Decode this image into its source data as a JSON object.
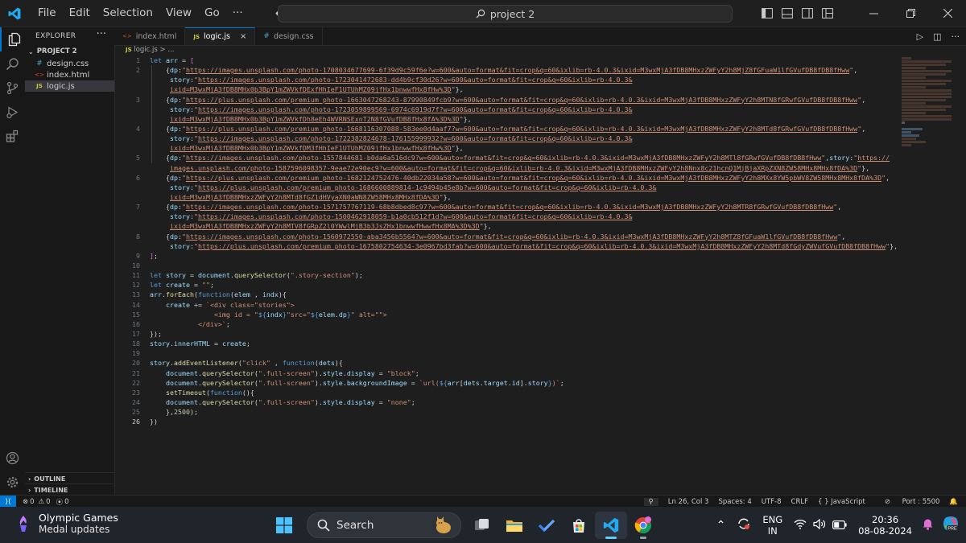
{
  "menu": [
    "File",
    "Edit",
    "Selection",
    "View",
    "Go"
  ],
  "menu_more": "···",
  "search_text": "project 2",
  "explorer": {
    "title": "EXPLORER",
    "more": "···",
    "project": "PROJECT 2",
    "files": [
      {
        "name": "design.css",
        "icon": "#",
        "color": "#519aba"
      },
      {
        "name": "index.html",
        "icon": "<>",
        "color": "#e44d26"
      },
      {
        "name": "logic.js",
        "icon": "JS",
        "color": "#cbcb41"
      }
    ],
    "outline": "OUTLINE",
    "timeline": "TIMELINE"
  },
  "tabs": [
    {
      "name": "index.html",
      "icon": "<>",
      "color": "#e44d26",
      "active": false
    },
    {
      "name": "logic.js",
      "icon": "JS",
      "color": "#cbcb41",
      "active": true,
      "close": "×"
    },
    {
      "name": "design.css",
      "icon": "#",
      "color": "#519aba",
      "active": false
    }
  ],
  "breadcrumb": {
    "icon": "JS",
    "file": "logic.js",
    "sep": ">",
    "rest": "..."
  },
  "status": {
    "errors": "0",
    "warnings": "0",
    "ports": "0",
    "position": "Ln 26, Col 3",
    "spaces": "Spaces: 4",
    "encoding": "UTF-8",
    "eol": "CRLF",
    "language": "{ } JavaScript",
    "port": "Port : 5500"
  },
  "taskbar": {
    "weather_title": "Olympic Games",
    "weather_sub": "Medal updates",
    "search_label": "Search",
    "lang_1": "ENG",
    "lang_2": "IN",
    "time": "20:36",
    "date": "08-08-2024"
  },
  "code_lines": [
    {
      "n": "1",
      "html": "<span class='kw'>let</span> <span class='vr'>arr</span> = <span class='br'>[</span>"
    },
    {
      "n": "2",
      "html": "    {<span class='vr'>dp</span>:<span class='str'>\"<span class='url'>https://images.unsplash.com/photo-1708034677699-6f39d9c59f6e?w=600&amp;auto=format&amp;fit=crop&amp;q=60&amp;ixlib=rb-4.0.3&amp;ixid=M3wxMjA3fDB8MHxzZWFyY2h8MjZ8fGFuaW1lfGVufDB8fDB8fHww</span>\"</span>,"
    },
    {
      "n": "",
      "html": "     <span class='vr'>story</span>:<span class='str'>\"<span class='url'>https://images.unsplash.com/photo-1723041472683-dd4b9cf30d26?w=600&amp;auto=format&amp;fit=crop&amp;q=60&amp;ixlib=rb-4.0.3&amp;</span></span>"
    },
    {
      "n": "",
      "html": "     <span class='str url'>ixid=M3wxMjA3fDB8MHx0b3BpY1mZWVkfDExfHhIeF1UTUhMZ09jfHx1bnwwfHx8fHw%3D</span><span class='str'>\"</span>},"
    },
    {
      "n": "3",
      "html": "    {<span class='vr'>dp</span>:<span class='str'>\"<span class='url'>https://plus.unsplash.com/premium_photo-1663047268243-87990849fcb9?w=600&amp;auto=format&amp;fit=crop&amp;q=60&amp;ixlib=rb-4.0.3&amp;ixid=M3wxMjA3fDB8MHxzZWFyY2h8MTN8fGRwfGVufDB8fDB8fHww</span>\"</span>,"
    },
    {
      "n": "",
      "html": "     <span class='vr'>story</span>:<span class='str'>\"<span class='url'>https://images.unsplash.com/photo-1723059899569-6974c6919d7f?w=600&amp;auto=format&amp;fit=crop&amp;q=60&amp;ixlib=rb-4.0.3&amp;</span></span>"
    },
    {
      "n": "",
      "html": "     <span class='str url'>ixid=M3wxMjA3fDB8MHx0b3BpY1mZWVkfDh8eEh4WVRNSExnT2N8fGVufDB8fHx8fA%3D%3D</span><span class='str'>\"</span>},"
    },
    {
      "n": "4",
      "html": "    {<span class='vr'>dp</span>:<span class='str'>\"<span class='url'>https://plus.unsplash.com/premium_photo-1668116307088-583ee0d4aaf7?w=600&amp;auto=format&amp;fit=crop&amp;q=60&amp;ixlib=rb-4.0.3&amp;ixid=M3wxMjA3fDB8MHxzZWFyY2h8MTd8fGRwfGVufDB8fDB8fHww</span>\"</span>,"
    },
    {
      "n": "",
      "html": "     <span class='vr'>story</span>:<span class='str'>\"<span class='url'>https://images.unsplash.com/photo-1722382824678-176155999932?w=600&amp;auto=format&amp;fit=crop&amp;q=60&amp;ixlib=rb-4.0.3&amp;</span></span>"
    },
    {
      "n": "",
      "html": "     <span class='str url'>ixid=M3wxMjA3fDB8MHx0b3BpY1mZWVkfDM3fHhIeF1UTUhMZ09jfHx1bnwwfHx8fHw%3D</span><span class='str'>\"</span>},"
    },
    {
      "n": "5",
      "html": "    {<span class='vr'>dp</span>:<span class='str'>\"<span class='url'>https://images.unsplash.com/photo-1557844681-b0da6a516dc9?w=600&amp;auto=format&amp;fit=crop&amp;q=60&amp;ixlib=rb-4.0.3&amp;ixid=M3wxMjA3fDB8MHxzZWFyY2h8MTl8fGRwfGVufDB8fDB8fHww</span>\"</span>,<span class='vr'>story</span>:<span class='str'>\"<span class='url'>https://</span></span>"
    },
    {
      "n": "",
      "html": "     <span class='str url'>images.unsplash.com/photo-1587596098357-9eae72e90ec9?w=600&amp;auto=format&amp;fit=crop&amp;q=60&amp;ixlib=rb-4.0.3&amp;ixid=M3wxMjA3fDB8MHxzZWFyY2h8Nnx8c21hcnQ1MjBjaXRpZXN8ZW58MHx8MHx8fDA%3D</span><span class='str'>\"</span>},"
    },
    {
      "n": "6",
      "html": "    {<span class='vr'>dp</span>:<span class='str'>\"<span class='url'>https://plus.unsplash.com/premium_photo-1682124752476-40db22034a58?w=600&amp;auto=format&amp;fit=crop&amp;q=60&amp;ixlib=rb-4.0.3&amp;ixid=M3wxMjA3fDB8MHxzZWFyY2h8MXx8YW5pbWV8ZW58MHx8MHx8fDA%3D</span>\"</span>,"
    },
    {
      "n": "",
      "html": "     <span class='vr'>story</span>:<span class='str'>\"<span class='url'>https://plus.unsplash.com/premium_photo-1686600889814-1c9494b45e8b?w=600&amp;auto=format&amp;fit=crop&amp;q=60&amp;ixlib=rb-4.0.3&amp;</span></span>"
    },
    {
      "n": "",
      "html": "     <span class='str url'>ixid=M3wxMjA3fDB8MHxzZWFyY2h8MTd8fGZ1dHVyaXN0aWN8ZW58MHx8MHx8fDA%3D</span><span class='str'>\"</span>},"
    },
    {
      "n": "7",
      "html": "    {<span class='vr'>dp</span>:<span class='str'>\"<span class='url'>https://images.unsplash.com/photo-1571757767119-68b8dbed8c97?w=600&amp;auto=format&amp;fit=crop&amp;q=60&amp;ixlib=rb-4.0.3&amp;ixid=M3wxMjA3fDB8MHxzZWFyY2h8MTR8fGRwfGVufDB8fDB8fHww</span>\"</span>,"
    },
    {
      "n": "",
      "html": "     <span class='vr'>story</span>:<span class='str'>\"<span class='url'>https://images.unsplash.com/photo-1500462918059-b1a0cb512f1d?w=600&amp;auto=format&amp;fit=crop&amp;q=60&amp;ixlib=rb-4.0.3&amp;</span></span>"
    },
    {
      "n": "",
      "html": "     <span class='str url'>ixid=M3wxMjA3fDB8MHxzZWFyY2h8MTV8fGRpZ2l0YWwlMjB3b3JsZHx1bnwwfHwwfHx8MA%3D%3D</span><span class='str'>\"</span>},"
    },
    {
      "n": "8",
      "html": "    {<span class='vr'>dp</span>:<span class='str'>\"<span class='url'>https://images.unsplash.com/photo-1560972550-aba3456b5564?w=600&amp;auto=format&amp;fit=crop&amp;q=60&amp;ixlib=rb-4.0.3&amp;ixid=M3wxMjA3fDB8MHxzZWFyY2h8MTZ8fGFuaW1lfGVufDB8fDB8fHww</span>\"</span>,"
    },
    {
      "n": "",
      "html": "     <span class='vr'>story</span>:<span class='str'>\"<span class='url'>https://plus.unsplash.com/premium_photo-1675802754634-3e0967bd3fab?w=600&amp;auto=format&amp;fit=crop&amp;q=60&amp;ixlib=rb-4.0.3&amp;ixid=M3wxMjA3fDB8MHxzZWFyY2h8MTd8fGdyZWVufGVufDB8fDB8fHww</span>\"</span>},"
    },
    {
      "n": "9",
      "html": "<span class='br'>]</span>;"
    },
    {
      "n": "10",
      "html": ""
    },
    {
      "n": "11",
      "html": "<span class='kw'>let</span> <span class='vr'>story</span> = <span class='vr'>document</span>.<span class='fn'>querySelector</span>(<span class='str'>\".story-section\"</span>);"
    },
    {
      "n": "12",
      "html": "<span class='kw'>let</span> <span class='vr'>create</span> = <span class='str'>\"\"</span>;"
    },
    {
      "n": "13",
      "html": "<span class='vr'>arr</span>.<span class='fn'>forEach</span>(<span class='kw'>function</span>(<span class='vr'>elem</span> , <span class='vr'>indx</span>){"
    },
    {
      "n": "14",
      "html": "    <span class='vr'>create</span> += <span class='tm'>`&lt;div class=\"stories\"&gt;</span>"
    },
    {
      "n": "15",
      "html": "<span class='tm'>                &lt;img id = \"</span><span class='kw'>${</span><span class='vr'>indx</span><span class='kw'>}</span><span class='tm'>\"src=\"</span><span class='kw'>${</span><span class='vr'>elem</span>.<span class='vr'>dp</span><span class='kw'>}</span><span class='tm'>\" alt=\"\"&gt;</span>"
    },
    {
      "n": "16",
      "html": "<span class='tm'>            &lt;/div&gt;`</span>;"
    },
    {
      "n": "17",
      "html": "});"
    },
    {
      "n": "18",
      "html": "<span class='vr'>story</span>.<span class='vr'>innerHTML</span> = <span class='vr'>create</span>;"
    },
    {
      "n": "19",
      "html": ""
    },
    {
      "n": "20",
      "html": "<span class='vr'>story</span>.<span class='fn'>addEventListener</span>(<span class='str'>\"click\"</span> , <span class='kw'>function</span>(<span class='vr'>dets</span>){"
    },
    {
      "n": "21",
      "html": "    <span class='vr'>document</span>.<span class='fn'>querySelector</span>(<span class='str'>\".full-screen\"</span>).<span class='vr'>style</span>.<span class='vr'>display</span> = <span class='str'>\"block\"</span>;"
    },
    {
      "n": "22",
      "html": "    <span class='vr'>document</span>.<span class='fn'>querySelector</span>(<span class='str'>\".full-screen\"</span>).<span class='vr'>style</span>.<span class='vr'>backgroundImage</span> = <span class='tm'>`url(</span><span class='kw'>${</span><span class='vr'>arr</span>[<span class='vr'>dets</span>.<span class='vr'>target</span>.<span class='vr'>id</span>].<span class='vr'>story</span><span class='kw'>}</span><span class='tm'>)`</span>;"
    },
    {
      "n": "23",
      "html": "    <span class='fn'>setTimeout</span>(<span class='kw'>function</span>(){"
    },
    {
      "n": "24",
      "html": "    <span class='vr'>document</span>.<span class='fn'>querySelector</span>(<span class='str'>\".full-screen\"</span>).<span class='vr'>style</span>.<span class='vr'>display</span> = <span class='str'>\"none\"</span>;"
    },
    {
      "n": "25",
      "html": "    },<span class='num'>2500</span>);"
    },
    {
      "n": "26",
      "html": "})"
    }
  ],
  "colors": {
    "accent": "#0078d4",
    "editor_bg": "#1e1e1e",
    "sidebar_bg": "#181818"
  }
}
